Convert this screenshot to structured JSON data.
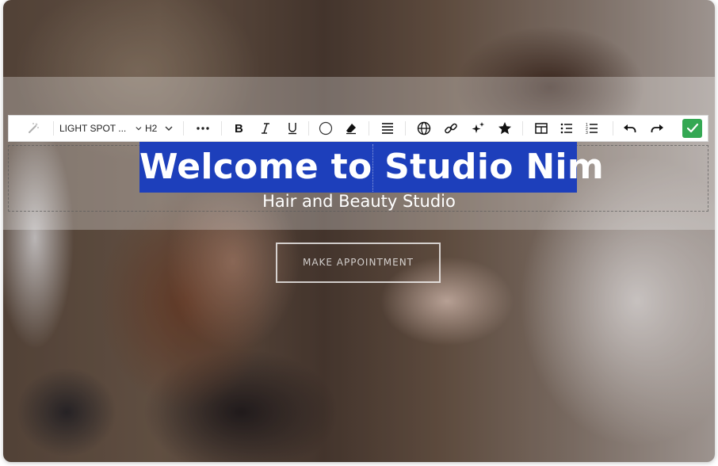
{
  "hero": {
    "heading": "Welcome to Studio Nim",
    "subtitle": "Hair and Beauty Studio",
    "cta_label": "MAKE APPOINTMENT"
  },
  "toolbar": {
    "font_style": "LIGHT SPOT ...",
    "heading_level": "H2",
    "tools": [
      "magic-wand",
      "font-style-dropdown",
      "heading-dropdown",
      "more",
      "bold",
      "italic",
      "underline",
      "color",
      "clear-format",
      "align",
      "globe",
      "link",
      "ai-sparkle",
      "star",
      "table",
      "bullet-list",
      "numbered-list",
      "undo",
      "redo",
      "confirm"
    ]
  },
  "colors": {
    "selection": "#1d3fbb",
    "confirm": "#34a853",
    "toolbar_bg": "#ffffff"
  }
}
